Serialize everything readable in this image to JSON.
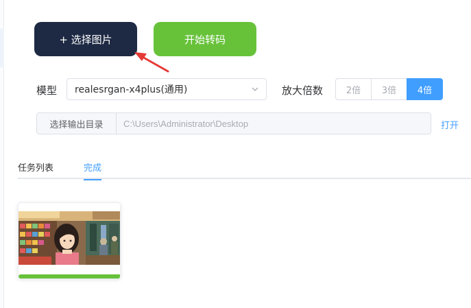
{
  "toolbar": {
    "select_image_label": "+ 选择图片",
    "start_convert_label": "开始转码"
  },
  "settings": {
    "model_label": "模型",
    "model_value": "realesrgan-x4plus(通用)",
    "scale_label": "放大倍数",
    "scale_options": [
      "2倍",
      "3倍",
      "4倍"
    ],
    "scale_selected": "4倍"
  },
  "output": {
    "button_label": "选择输出目录",
    "path": "C:\\Users\\Administrator\\Desktop",
    "open_label": "打开"
  },
  "tabs": {
    "task_list": "任务列表",
    "done": "完成",
    "active": "完成"
  },
  "results": [
    {
      "thumbnail_icon": "anime-girl-shop-image",
      "progress": 1.0
    }
  ],
  "colors": {
    "primary": "#409eff",
    "success": "#67c23a",
    "dark_button": "#1e2a44",
    "annotation_arrow": "#e53935"
  }
}
